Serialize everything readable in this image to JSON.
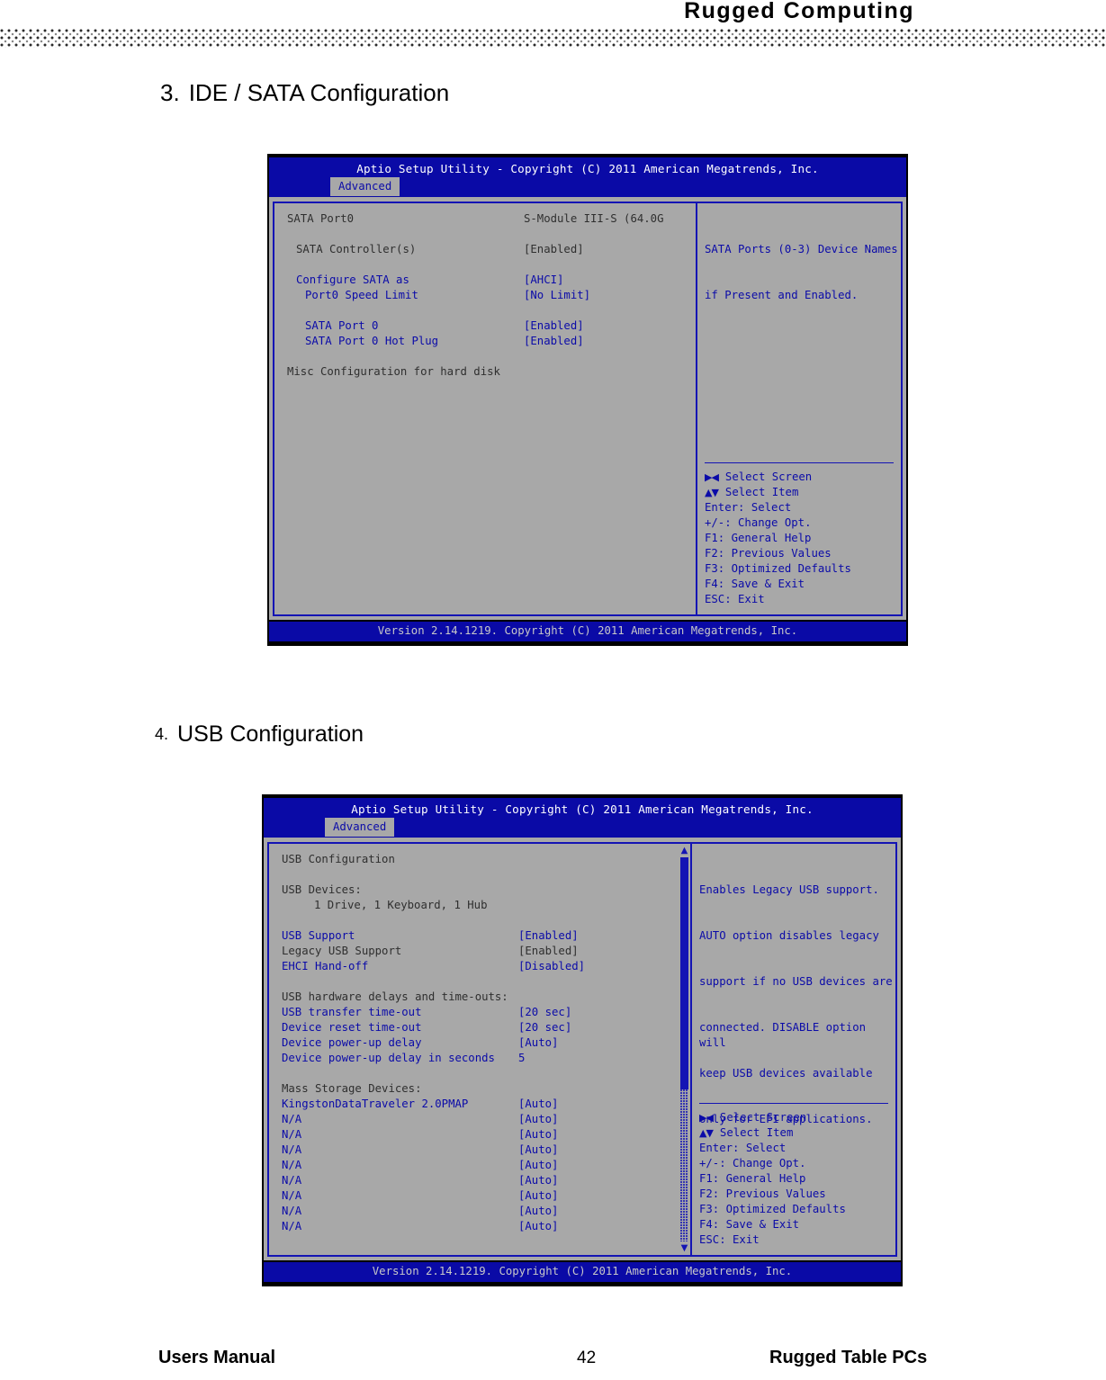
{
  "header": {
    "brand": "Rugged  Computing"
  },
  "sections": [
    {
      "number": "3.",
      "title": "IDE / SATA Configuration"
    },
    {
      "number": "4.",
      "title": "USB Configuration"
    }
  ],
  "bios_common": {
    "title": "Aptio Setup Utility - Copyright (C) 2011 American Megatrends, Inc.",
    "tab": "Advanced",
    "version_bar": "Version 2.14.1219. Copyright (C) 2011 American Megatrends, Inc.",
    "keys": [
      {
        "key": "→←:",
        "action": "Select Screen"
      },
      {
        "key": "↑↓:",
        "action": "Select Item"
      },
      {
        "key": "Enter:",
        "action": "Select"
      },
      {
        "key": "+/-:",
        "action": "Change Opt."
      },
      {
        "key": "F1:",
        "action": "General Help"
      },
      {
        "key": "F2:",
        "action": "Previous Values"
      },
      {
        "key": "F3:",
        "action": "Optimized Defaults"
      },
      {
        "key": "F4:",
        "action": "Save & Exit"
      },
      {
        "key": "ESC:",
        "action": "Exit"
      }
    ]
  },
  "sata_screen": {
    "items": [
      {
        "label": "SATA Port0",
        "value": "S-Module III-S (64.0G",
        "indent": 0,
        "style": "gray"
      },
      {
        "label": "",
        "value": "",
        "indent": 0,
        "style": "blank"
      },
      {
        "label": "SATA Controller(s)",
        "value": "[Enabled]",
        "indent": 1,
        "style": "gray"
      },
      {
        "label": "",
        "value": "",
        "indent": 0,
        "style": "blank"
      },
      {
        "label": "Configure SATA as",
        "value": "[AHCI]",
        "indent": 1,
        "style": "blue"
      },
      {
        "label": "Port0 Speed Limit",
        "value": "[No Limit]",
        "indent": 2,
        "style": "blue"
      },
      {
        "label": "",
        "value": "",
        "indent": 0,
        "style": "blank"
      },
      {
        "label": "SATA Port 0",
        "value": "[Enabled]",
        "indent": 2,
        "style": "blue"
      },
      {
        "label": "SATA Port 0 Hot Plug",
        "value": "[Enabled]",
        "indent": 2,
        "style": "blue"
      },
      {
        "label": "",
        "value": "",
        "indent": 0,
        "style": "blank"
      },
      {
        "label": "Misc Configuration for hard disk",
        "value": "",
        "indent": 0,
        "style": "gray"
      }
    ],
    "help": [
      "SATA Ports (0-3) Device Names",
      "if Present and Enabled."
    ]
  },
  "usb_screen": {
    "items": [
      {
        "label": "USB Configuration",
        "value": "",
        "indent": 0,
        "style": "gray"
      },
      {
        "label": "",
        "value": "",
        "indent": 0,
        "style": "blank"
      },
      {
        "label": "USB Devices:",
        "value": "",
        "indent": 0,
        "style": "gray"
      },
      {
        "label": "1 Drive, 1 Keyboard, 1 Hub",
        "value": "",
        "indent": 3,
        "style": "gray"
      },
      {
        "label": "",
        "value": "",
        "indent": 0,
        "style": "blank"
      },
      {
        "label": "USB Support",
        "value": "[Enabled]",
        "indent": 0,
        "style": "blue"
      },
      {
        "label": "Legacy USB Support",
        "value": "[Enabled]",
        "indent": 0,
        "style": "gray"
      },
      {
        "label": "EHCI Hand-off",
        "value": "[Disabled]",
        "indent": 0,
        "style": "blue"
      },
      {
        "label": "",
        "value": "",
        "indent": 0,
        "style": "blank"
      },
      {
        "label": "USB hardware delays and time-outs:",
        "value": "",
        "indent": 0,
        "style": "gray"
      },
      {
        "label": "USB transfer time-out",
        "value": "[20 sec]",
        "indent": 0,
        "style": "blue"
      },
      {
        "label": "Device reset time-out",
        "value": "[20 sec]",
        "indent": 0,
        "style": "blue"
      },
      {
        "label": "Device power-up delay",
        "value": "[Auto]",
        "indent": 0,
        "style": "blue"
      },
      {
        "label": "Device power-up delay in seconds",
        "value": "5",
        "indent": 0,
        "style": "blue"
      },
      {
        "label": "",
        "value": "",
        "indent": 0,
        "style": "blank"
      },
      {
        "label": "Mass Storage Devices:",
        "value": "",
        "indent": 0,
        "style": "gray"
      },
      {
        "label": "KingstonDataTraveler 2.0PMAP",
        "value": "[Auto]",
        "indent": 0,
        "style": "blue"
      },
      {
        "label": "N/A",
        "value": "[Auto]",
        "indent": 0,
        "style": "blue"
      },
      {
        "label": "N/A",
        "value": "[Auto]",
        "indent": 0,
        "style": "blue"
      },
      {
        "label": "N/A",
        "value": "[Auto]",
        "indent": 0,
        "style": "blue"
      },
      {
        "label": "N/A",
        "value": "[Auto]",
        "indent": 0,
        "style": "blue"
      },
      {
        "label": "N/A",
        "value": "[Auto]",
        "indent": 0,
        "style": "blue"
      },
      {
        "label": "N/A",
        "value": "[Auto]",
        "indent": 0,
        "style": "blue"
      },
      {
        "label": "N/A",
        "value": "[Auto]",
        "indent": 0,
        "style": "blue"
      },
      {
        "label": "N/A",
        "value": "[Auto]",
        "indent": 0,
        "style": "blue"
      }
    ],
    "help": [
      "Enables Legacy USB support.",
      "AUTO option disables legacy",
      "support if no USB devices are",
      "connected. DISABLE option will",
      "keep USB devices available",
      "only for EFI applications."
    ],
    "scrollbar": {
      "up_arrow": "▲",
      "down_arrow": "▼"
    }
  },
  "footer": {
    "left": "Users Manual",
    "page": "42",
    "right": "Rugged Table PCs"
  },
  "colors": {
    "bios_blue": "#0a0aa6",
    "bios_gray": "#a8a8a8",
    "bios_text_blue": "#0b0ba8",
    "bios_text_gray": "#2f2f2f",
    "border_blue": "#1414b4"
  }
}
